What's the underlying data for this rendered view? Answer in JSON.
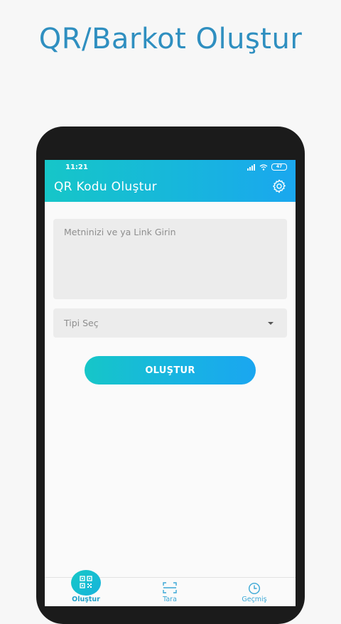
{
  "promo": {
    "title": "QR/Barkot Oluştur"
  },
  "status_bar": {
    "time": "11:21",
    "battery": "47"
  },
  "app_bar": {
    "title": "QR Kodu Oluştur",
    "settings_icon": "gear-icon"
  },
  "form": {
    "text_input": {
      "placeholder": "Metninizi ve ya Link Girin",
      "value": ""
    },
    "type_select": {
      "selected": "Tipi Seç"
    },
    "create_button": "OLUŞTUR"
  },
  "bottom_nav": {
    "items": [
      {
        "label": "Oluştur",
        "icon": "qr-code-icon",
        "active": true
      },
      {
        "label": "Tara",
        "icon": "scan-icon",
        "active": false
      },
      {
        "label": "Geçmiş",
        "icon": "clock-icon",
        "active": false
      }
    ]
  },
  "colors": {
    "accent_start": "#16c6c8",
    "accent_end": "#1aa7ef",
    "promo_text": "#2f8fc0"
  }
}
